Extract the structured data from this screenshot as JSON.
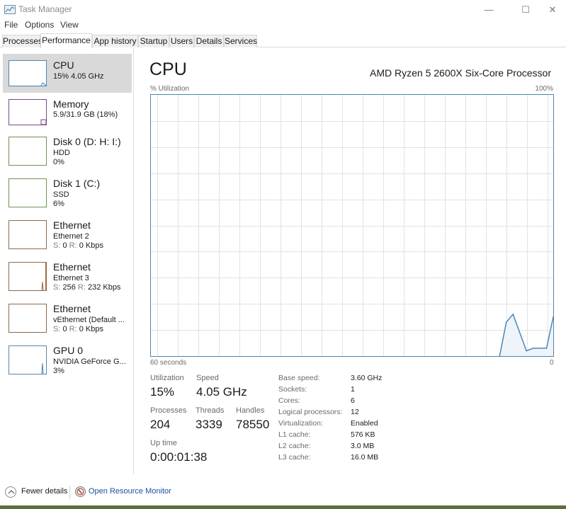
{
  "window": {
    "title": "Task Manager",
    "icon": "task-manager-icon",
    "controls": {
      "minimize": "—",
      "maximize": "☐",
      "close": "✕"
    }
  },
  "menu": [
    "File",
    "Options",
    "View"
  ],
  "tabs": [
    {
      "label": "Processes",
      "active": false
    },
    {
      "label": "Performance",
      "active": true
    },
    {
      "label": "App history",
      "active": false
    },
    {
      "label": "Startup",
      "active": false
    },
    {
      "label": "Users",
      "active": false
    },
    {
      "label": "Details",
      "active": false
    },
    {
      "label": "Services",
      "active": false
    }
  ],
  "sidebar": {
    "items": [
      {
        "title": "CPU",
        "line1": "15% 4.05 GHz",
        "line2": "",
        "color": "#4b86b4",
        "selected": true
      },
      {
        "title": "Memory",
        "line1": "5.9/31.9 GB (18%)",
        "line2": "",
        "color": "#7a4a8c",
        "selected": false
      },
      {
        "title": "Disk 0 (D: H: I:)",
        "line1": "HDD",
        "line2": "0%",
        "color": "#6f9150",
        "selected": false
      },
      {
        "title": "Disk 1 (C:)",
        "line1": "SSD",
        "line2": "6%",
        "color": "#6f9150",
        "selected": false
      },
      {
        "title": "Ethernet",
        "line1": "Ethernet 2",
        "send_label": "S:",
        "send": "0",
        "recv_label": "R:",
        "recv": "0 Kbps",
        "color": "#8a6a4e",
        "selected": false
      },
      {
        "title": "Ethernet",
        "line1": "Ethernet 3",
        "send_label": "S:",
        "send": "256",
        "recv_label": "R:",
        "recv": "232 Kbps",
        "color": "#8a6a4e",
        "selected": false
      },
      {
        "title": "Ethernet",
        "line1": "vEthernet (Default ...",
        "send_label": "S:",
        "send": "0",
        "recv_label": "R:",
        "recv": "0 Kbps",
        "color": "#8a6a4e",
        "selected": false
      },
      {
        "title": "GPU 0",
        "line1": "NVIDIA GeForce G...",
        "line2": "3%",
        "color": "#5a86aa",
        "selected": false
      }
    ]
  },
  "main": {
    "title": "CPU",
    "model": "AMD Ryzen 5 2600X Six-Core Processor",
    "graph": {
      "ylabel": "% Utilization",
      "ymax_label": "100%",
      "xlabel_left": "60 seconds",
      "xlabel_right": "0",
      "line_color": "#4b86b4",
      "fill_color": "#eef4fa",
      "grid_color": "#e2e2e2"
    },
    "stats": {
      "utilization_label": "Utilization",
      "utilization": "15%",
      "speed_label": "Speed",
      "speed": "4.05 GHz",
      "processes_label": "Processes",
      "processes": "204",
      "threads_label": "Threads",
      "threads": "3339",
      "handles_label": "Handles",
      "handles": "78550",
      "uptime_label": "Up time",
      "uptime": "0:00:01:38"
    },
    "specs": [
      {
        "label": "Base speed:",
        "value": "3.60 GHz"
      },
      {
        "label": "Sockets:",
        "value": "1"
      },
      {
        "label": "Cores:",
        "value": "6"
      },
      {
        "label": "Logical processors:",
        "value": "12"
      },
      {
        "label": "Virtualization:",
        "value": "Enabled"
      },
      {
        "label": "L1 cache:",
        "value": "576 KB"
      },
      {
        "label": "L2 cache:",
        "value": "3.0 MB"
      },
      {
        "label": "L3 cache:",
        "value": "16.0 MB"
      }
    ]
  },
  "chart_data": {
    "type": "area",
    "title": "CPU % Utilization",
    "xlabel": "60 seconds",
    "ylabel": "% Utilization",
    "xlim": [
      60,
      0
    ],
    "ylim": [
      0,
      100
    ],
    "grid": true,
    "x_seconds_ago": [
      8,
      7,
      6,
      5,
      4,
      3,
      2,
      1,
      0
    ],
    "values": [
      0,
      13,
      16,
      9,
      2,
      3,
      3,
      3,
      15
    ]
  },
  "footer": {
    "fewer_details": "Fewer details",
    "open_resource_monitor": "Open Resource Monitor"
  }
}
